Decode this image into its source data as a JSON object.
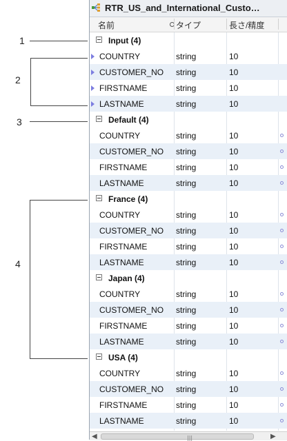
{
  "callouts": [
    "1",
    "2",
    "3",
    "4"
  ],
  "panel": {
    "title": "RTR_US_and_International_Custo…",
    "icon": "router-transformation-icon",
    "columns": {
      "name": "名前",
      "type": "タイプ",
      "length": "長さ/精度"
    }
  },
  "groups": [
    {
      "label": "Input (4)",
      "rows": [
        {
          "name": "COUNTRY",
          "type": "string",
          "len": "10"
        },
        {
          "name": "CUSTOMER_NO",
          "type": "string",
          "len": "10"
        },
        {
          "name": "FIRSTNAME",
          "type": "string",
          "len": "10"
        },
        {
          "name": "LASTNAME",
          "type": "string",
          "len": "10"
        }
      ]
    },
    {
      "label": "Default (4)",
      "rows": [
        {
          "name": "COUNTRY",
          "type": "string",
          "len": "10"
        },
        {
          "name": "CUSTOMER_NO",
          "type": "string",
          "len": "10"
        },
        {
          "name": "FIRSTNAME",
          "type": "string",
          "len": "10"
        },
        {
          "name": "LASTNAME",
          "type": "string",
          "len": "10"
        }
      ]
    },
    {
      "label": "France (4)",
      "rows": [
        {
          "name": "COUNTRY",
          "type": "string",
          "len": "10"
        },
        {
          "name": "CUSTOMER_NO",
          "type": "string",
          "len": "10"
        },
        {
          "name": "FIRSTNAME",
          "type": "string",
          "len": "10"
        },
        {
          "name": "LASTNAME",
          "type": "string",
          "len": "10"
        }
      ]
    },
    {
      "label": "Japan (4)",
      "rows": [
        {
          "name": "COUNTRY",
          "type": "string",
          "len": "10"
        },
        {
          "name": "CUSTOMER_NO",
          "type": "string",
          "len": "10"
        },
        {
          "name": "FIRSTNAME",
          "type": "string",
          "len": "10"
        },
        {
          "name": "LASTNAME",
          "type": "string",
          "len": "10"
        }
      ]
    },
    {
      "label": "USA (4)",
      "rows": [
        {
          "name": "COUNTRY",
          "type": "string",
          "len": "10"
        },
        {
          "name": "CUSTOMER_NO",
          "type": "string",
          "len": "10"
        },
        {
          "name": "FIRSTNAME",
          "type": "string",
          "len": "10"
        },
        {
          "name": "LASTNAME",
          "type": "string",
          "len": "10"
        }
      ]
    }
  ],
  "scrollbar": {
    "grip": "|||"
  }
}
